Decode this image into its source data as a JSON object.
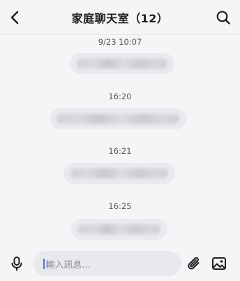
{
  "header": {
    "title": "家庭聊天室（12）",
    "back_icon": "back-chevron-icon",
    "search_icon": "search-icon"
  },
  "messages": [
    {
      "timestamp": "9/23 10:07"
    },
    {
      "timestamp": "16:20"
    },
    {
      "timestamp": "16:21"
    },
    {
      "timestamp": "16:25"
    }
  ],
  "composer": {
    "placeholder": "輸入訊息...",
    "mic_icon": "microphone-icon",
    "attach_icon": "paperclip-icon",
    "image_icon": "image-icon"
  },
  "colors": {
    "background": "#f4f5f7",
    "bubble": "#e9eaed",
    "input_bg": "#e8e9ec",
    "caret": "#4a6cf7"
  }
}
